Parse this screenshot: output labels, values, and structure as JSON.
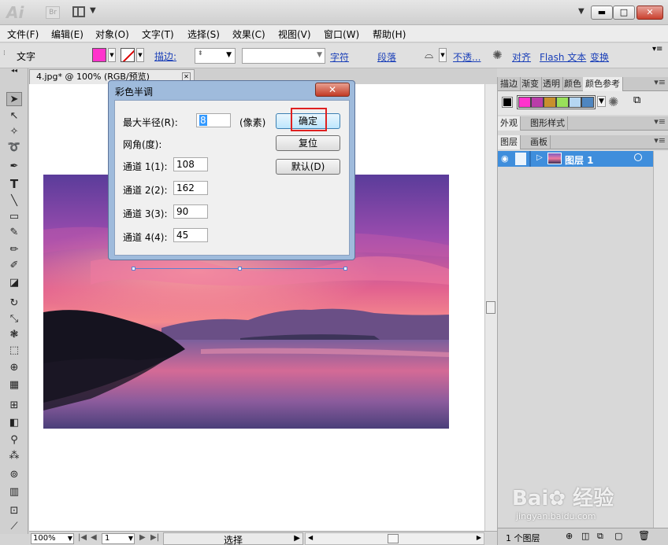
{
  "app": {
    "logo": "Ai",
    "bridge_label": "Br"
  },
  "window_controls": {
    "minimize": "▬",
    "maximize": "□",
    "close": "✕",
    "workspace_dropdown": "▼"
  },
  "menu": [
    "文件(F)",
    "编辑(E)",
    "对象(O)",
    "文字(T)",
    "选择(S)",
    "效果(C)",
    "视图(V)",
    "窗口(W)",
    "帮助(H)"
  ],
  "control_bar": {
    "tool_label": "文字",
    "fill_color": "#ff33cc",
    "stroke_label": "描边:",
    "character_link": "字符",
    "paragraph_link": "段落",
    "opacity_link": "不透...",
    "align_link": "对齐",
    "flash_text_link": "Flash 文本",
    "transform_link": "变换"
  },
  "document": {
    "tab_title": "4.jpg* @ 100% (RGB/预览)",
    "zoom": "100%",
    "artboard_number": "1",
    "status_text": "选择"
  },
  "dialog": {
    "title": "彩色半调",
    "close_label": "✕",
    "max_radius_label": "最大半径(R):",
    "max_radius_value": "8",
    "unit_label": "(像素)",
    "screen_angle_label": "网角(度):",
    "channels": [
      {
        "label": "通道 1(1):",
        "value": "108"
      },
      {
        "label": "通道 2(2):",
        "value": "162"
      },
      {
        "label": "通道 3(3):",
        "value": "90"
      },
      {
        "label": "通道 4(4):",
        "value": "45"
      }
    ],
    "ok_button": "确定",
    "reset_button": "复位",
    "default_button": "默认(D)"
  },
  "panels": {
    "top_tabs": [
      "描边",
      "渐变",
      "透明",
      "颜色",
      "颜色参考"
    ],
    "guide_swatches": [
      "#ff33cc",
      "#b93da8",
      "#c8902c",
      "#99e05a",
      "#b5d6f2",
      "#4f86c0"
    ],
    "appearance_tabs": [
      "外观",
      "图形样式"
    ],
    "layer_tabs": [
      "图层",
      "画板"
    ],
    "layer_name": "图层 1",
    "layer_count": "1 个图层"
  },
  "watermark": {
    "brand": "Bai✿ 经验",
    "url": "jingyan.baidu.com"
  }
}
